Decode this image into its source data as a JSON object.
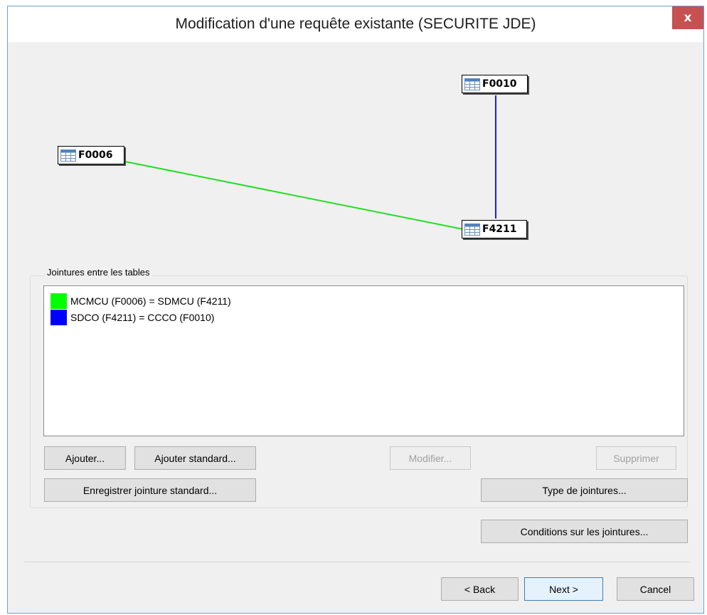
{
  "window": {
    "title": "Modification d'une requête existante (SECURITE JDE)",
    "close_label": "x"
  },
  "diagram": {
    "tables": [
      {
        "name": "F0010"
      },
      {
        "name": "F0006"
      },
      {
        "name": "F4211"
      }
    ],
    "links": [
      {
        "from": "F0006",
        "to": "F4211",
        "color": "#1fe01f"
      },
      {
        "from": "F0010",
        "to": "F4211",
        "color": "#1a1aef"
      }
    ]
  },
  "joins": {
    "group_label": "Jointures entre les tables",
    "items": [
      {
        "text": "MCMCU (F0006) = SDMCU (F4211)",
        "color": "#00ff00"
      },
      {
        "text": "SDCO (F4211) = CCCO (F0010)",
        "color": "#0000ff"
      }
    ]
  },
  "buttons": {
    "add": "Ajouter...",
    "add_standard": "Ajouter standard...",
    "modify": "Modifier...",
    "delete": "Supprimer",
    "save_standard": "Enregistrer jointure standard...",
    "join_type": "Type de jointures...",
    "join_conditions": "Conditions sur les jointures...",
    "back": "< Back",
    "next": "Next >",
    "cancel": "Cancel"
  }
}
